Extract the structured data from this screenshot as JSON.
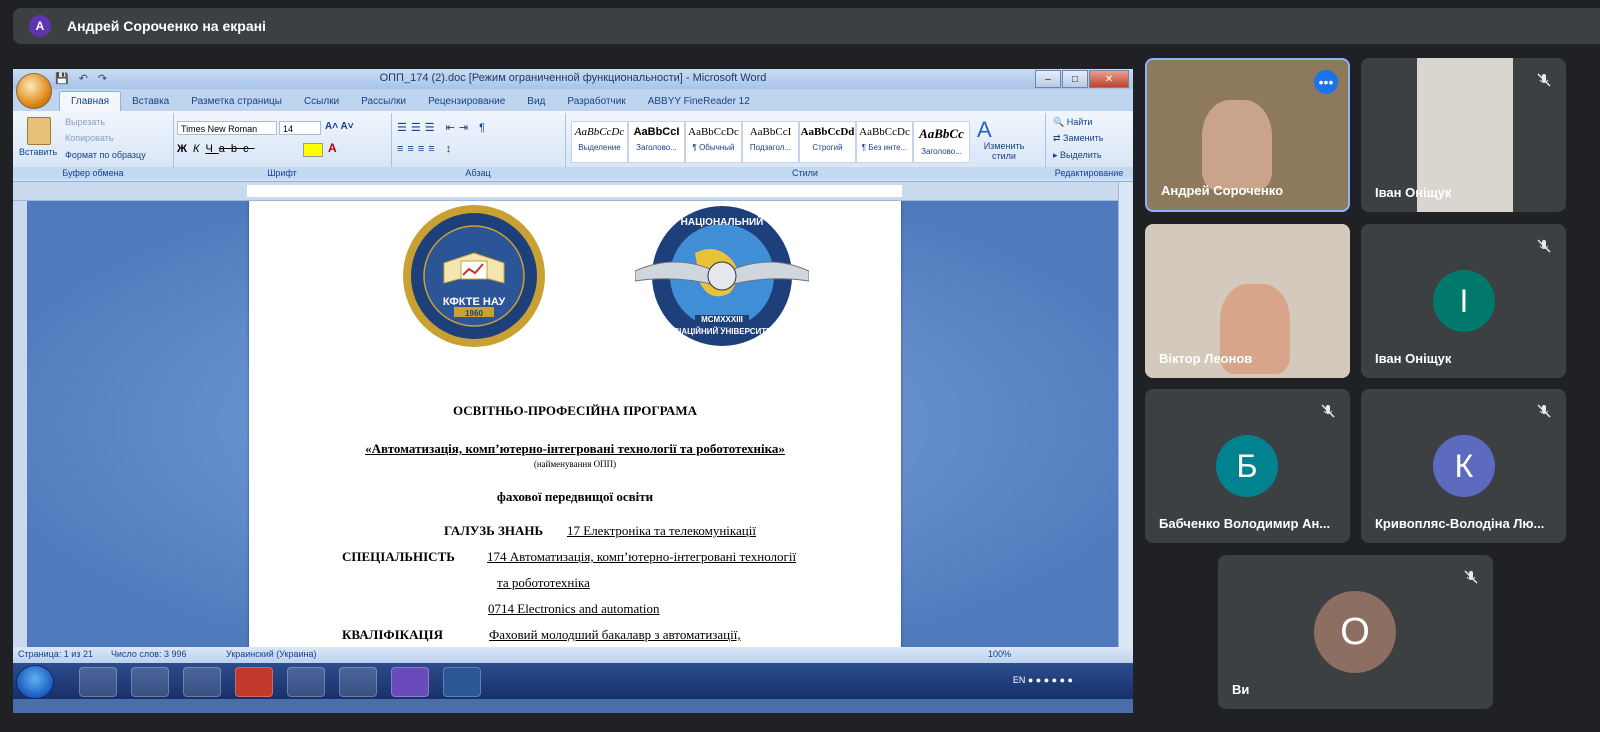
{
  "presenter": {
    "initial": "А",
    "text": "Андрей Сороченко на екрані"
  },
  "word": {
    "title": "ОПП_174 (2).doc [Режим ограниченной функциональности] - Microsoft Word",
    "tabs": [
      "Главная",
      "Вставка",
      "Разметка страницы",
      "Ссылки",
      "Рассылки",
      "Рецензирование",
      "Вид",
      "Разработчик",
      "ABBYY FineReader 12"
    ],
    "clipboard": {
      "paste": "Вставить",
      "cut": "Вырезать",
      "copy": "Копировать",
      "format": "Формат по образцу",
      "label": "Буфер обмена"
    },
    "font": {
      "name": "Times New Roman",
      "size": "14",
      "label": "Шрифт"
    },
    "paragraph_label": "Абзац",
    "styles": [
      {
        "sample": "AaBbCcDc",
        "name": "Выделение"
      },
      {
        "sample": "AaBbCcI",
        "name": "Заголово..."
      },
      {
        "sample": "AaBbCcDc",
        "name": "¶ Обычный"
      },
      {
        "sample": "AaBbCcI",
        "name": "Подзагол..."
      },
      {
        "sample": "AaBbCcDd",
        "name": "Строгий"
      },
      {
        "sample": "AaBbCcDc",
        "name": "¶ Без инте..."
      },
      {
        "sample": "AaBbCc",
        "name": "Заголово..."
      }
    ],
    "styles_label": "Стили",
    "change_styles": "Изменить стили",
    "editing": {
      "find": "Найти",
      "replace": "Заменить",
      "select": "Выделить",
      "label": "Редактирование"
    },
    "logo1": {
      "line1": "КФКТЕ НАУ",
      "line2": "1960"
    },
    "logo2": {
      "line1": "НАЦІОНАЛЬНИЙ",
      "line2": "АВІАЦІЙНИЙ УНІВЕРСИТЕТ",
      "line3": "MCMXXXIII"
    },
    "document": {
      "heading": "ОСВІТНЬО-ПРОФЕСІЙНА ПРОГРАМА",
      "program": "«Автоматизація, комп’ютерно-інтегровані технології та робототехніка»",
      "program_note": "(найменування ОПП)",
      "level": "фахової передвищої освіти",
      "field_label": "ГАЛУЗЬ ЗНАНЬ",
      "field_value": "17 Електроніка та телекомунікації",
      "spec_label": "СПЕЦІАЛЬНІСТЬ",
      "spec_value1": "174 Автоматизація, комп’ютерно-інтегровані технології",
      "spec_value2": "та робототехніка",
      "spec_value3": "0714 Electronics and automation",
      "qual_label": "КВАЛІФІКАЦІЯ",
      "qual_value": "Фаховий молодший бакалавр з автоматизації,"
    },
    "status": {
      "page": "Страница: 1 из 21",
      "words": "Число слов: 3 996",
      "lang": "Украинский (Украина)",
      "zoom": "100%"
    },
    "tray": {
      "lang": "EN"
    }
  },
  "participants": [
    {
      "name": "Андрей Сороченко",
      "initial": "",
      "color": "#7a6a50"
    },
    {
      "name": "Іван Оніщук",
      "initial": "",
      "color": "#b9b4aa"
    },
    {
      "name": "Віктор Леонов",
      "initial": "",
      "color": "#c7b9a8"
    },
    {
      "name": "Іван Оніщук",
      "initial": "I",
      "color": "#00796b"
    },
    {
      "name": "Бабченко Володимир Ан...",
      "initial": "Б",
      "color": "#00838f"
    },
    {
      "name": "Кривопляс-Володіна Лю...",
      "initial": "К",
      "color": "#5c6bc0"
    },
    {
      "name": "Ви",
      "initial": "О",
      "color": "#8d6e63"
    }
  ],
  "colors": {
    "accent": "#8ab4f8",
    "speaking_badge": "#1a73e8"
  }
}
